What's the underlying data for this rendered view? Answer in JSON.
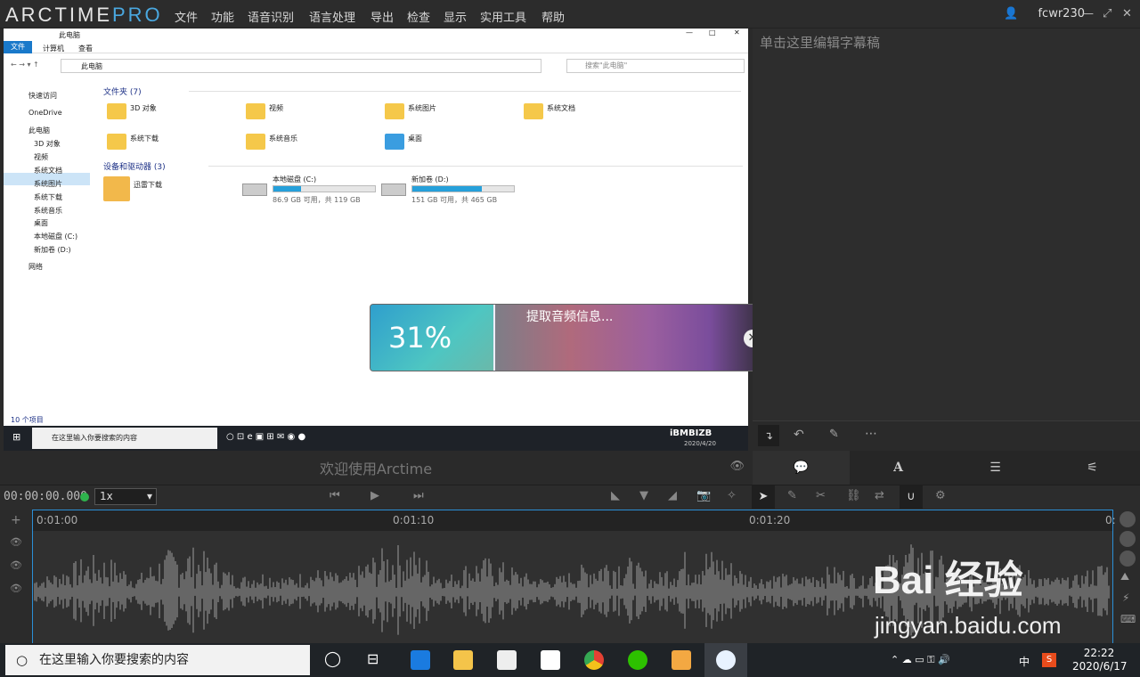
{
  "app": {
    "logo_main": "ARCTIME",
    "logo_pro": "PRO",
    "user": "fcwr230"
  },
  "menu": [
    "文件",
    "功能",
    "语音识别",
    "语言处理",
    "导出",
    "检查",
    "显示",
    "实用工具",
    "帮助"
  ],
  "right_panel": {
    "hint": "单击这里编辑字幕稿"
  },
  "welcome": "欢迎使用Arctime",
  "transport": {
    "timecode": "00:00:00.000",
    "speed": "1x"
  },
  "timeline": {
    "ruler_labels": [
      "0:01:00",
      "0:01:10",
      "0:01:20",
      "0:"
    ]
  },
  "loader": {
    "percent": "31%",
    "message": "提取音频信息...",
    "progress": 0.31
  },
  "explorer": {
    "title": "此电脑",
    "file_tab": "文件",
    "tabs": [
      "计算机",
      "查看"
    ],
    "address": "此电脑",
    "search_placeholder": "搜索\"此电脑\"",
    "nav": [
      "快速访问",
      "OneDrive",
      "此电脑",
      "3D 对象",
      "视频",
      "系统文档",
      "系统图片",
      "系统下载",
      "系统音乐",
      "桌面",
      "本地磁盘 (C:)",
      "新加卷 (D:)",
      "网络"
    ],
    "folders_header": "文件夹 (7)",
    "folders": [
      "3D 对象",
      "视频",
      "系统图片",
      "系统文档",
      "系统下载",
      "系统音乐",
      "桌面"
    ],
    "devices_header": "设备和驱动器 (3)",
    "devices": [
      {
        "name": "迅雷下载",
        "detail": ""
      },
      {
        "name": "本地磁盘 (C:)",
        "detail": "86.9 GB 可用，共 119 GB",
        "used": 0.27
      },
      {
        "name": "新加卷 (D:)",
        "detail": "151 GB 可用，共 465 GB",
        "used": 0.68
      }
    ],
    "status": "10 个项目",
    "taskbar_search": "在这里输入你要搜索的内容",
    "watermark": "iBMBIZB",
    "date": "2020/4/20"
  },
  "taskbar": {
    "search": "在这里输入你要搜索的内容",
    "ime": "中",
    "time": "22:22",
    "date": "2020/6/17"
  },
  "watermark": {
    "logo": "Bai 经验",
    "url": "jingyan.baidu.com"
  }
}
